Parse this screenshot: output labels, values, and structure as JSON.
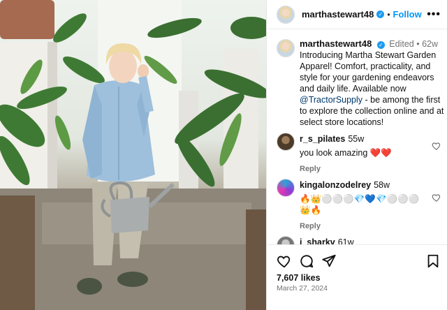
{
  "header": {
    "username": "marthastewart48",
    "follow_label": "Follow",
    "separator": "•",
    "more_label": "•••"
  },
  "caption": {
    "username": "marthastewart48",
    "edited": "Edited",
    "separator": "•",
    "age": "62w",
    "text_before": "Introducing Martha Stewart Garden Apparel! Comfort, practicality, and style for your gardening endeavors and daily life. Available now ",
    "mention": "@TractorSupply",
    "text_after": " - be among the first to explore the collection online and at select store locations!"
  },
  "comments": [
    {
      "username": "r_s_pilates",
      "age": "55w",
      "text": "you look amazing ❤️❤️",
      "reply_label": "Reply"
    },
    {
      "username": "kingalonzodelrey",
      "age": "58w",
      "text": "🔥👑⚪⚪⚪💎💙💎⚪⚪⚪ 👑🔥",
      "reply_label": "Reply"
    },
    {
      "username": "i_sharkv",
      "age": "61w"
    }
  ],
  "footer": {
    "likes": "7,607 likes",
    "date": "March 27, 2024"
  },
  "colors": {
    "accent": "#0095f6",
    "verified": "#1d9bf0",
    "mention": "#00376b",
    "muted": "#737373"
  },
  "icons": [
    "verified-icon",
    "more-icon",
    "heart-icon",
    "comment-icon",
    "share-icon",
    "bookmark-icon"
  ]
}
